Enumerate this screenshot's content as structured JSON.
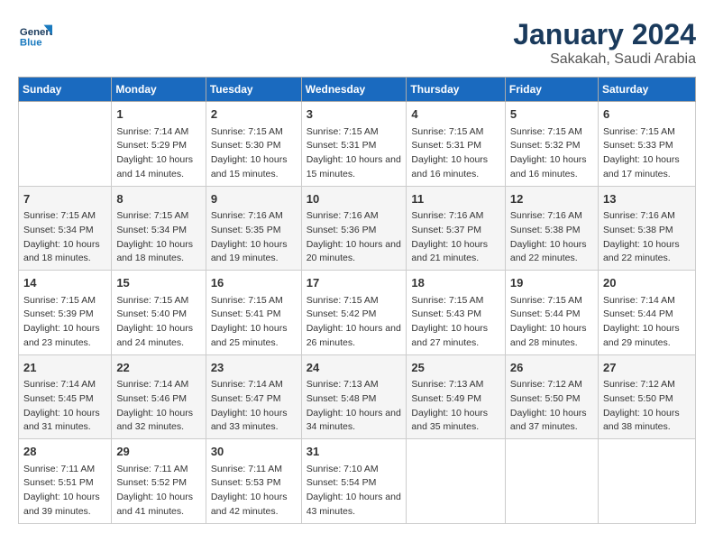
{
  "header": {
    "logo_general": "General",
    "logo_blue": "Blue",
    "month_year": "January 2024",
    "location": "Sakakah, Saudi Arabia"
  },
  "columns": [
    "Sunday",
    "Monday",
    "Tuesday",
    "Wednesday",
    "Thursday",
    "Friday",
    "Saturday"
  ],
  "weeks": [
    [
      {
        "day": "",
        "sunrise": "",
        "sunset": "",
        "daylight": ""
      },
      {
        "day": "1",
        "sunrise": "Sunrise: 7:14 AM",
        "sunset": "Sunset: 5:29 PM",
        "daylight": "Daylight: 10 hours and 14 minutes."
      },
      {
        "day": "2",
        "sunrise": "Sunrise: 7:15 AM",
        "sunset": "Sunset: 5:30 PM",
        "daylight": "Daylight: 10 hours and 15 minutes."
      },
      {
        "day": "3",
        "sunrise": "Sunrise: 7:15 AM",
        "sunset": "Sunset: 5:31 PM",
        "daylight": "Daylight: 10 hours and 15 minutes."
      },
      {
        "day": "4",
        "sunrise": "Sunrise: 7:15 AM",
        "sunset": "Sunset: 5:31 PM",
        "daylight": "Daylight: 10 hours and 16 minutes."
      },
      {
        "day": "5",
        "sunrise": "Sunrise: 7:15 AM",
        "sunset": "Sunset: 5:32 PM",
        "daylight": "Daylight: 10 hours and 16 minutes."
      },
      {
        "day": "6",
        "sunrise": "Sunrise: 7:15 AM",
        "sunset": "Sunset: 5:33 PM",
        "daylight": "Daylight: 10 hours and 17 minutes."
      }
    ],
    [
      {
        "day": "7",
        "sunrise": "Sunrise: 7:15 AM",
        "sunset": "Sunset: 5:34 PM",
        "daylight": "Daylight: 10 hours and 18 minutes."
      },
      {
        "day": "8",
        "sunrise": "Sunrise: 7:15 AM",
        "sunset": "Sunset: 5:34 PM",
        "daylight": "Daylight: 10 hours and 18 minutes."
      },
      {
        "day": "9",
        "sunrise": "Sunrise: 7:16 AM",
        "sunset": "Sunset: 5:35 PM",
        "daylight": "Daylight: 10 hours and 19 minutes."
      },
      {
        "day": "10",
        "sunrise": "Sunrise: 7:16 AM",
        "sunset": "Sunset: 5:36 PM",
        "daylight": "Daylight: 10 hours and 20 minutes."
      },
      {
        "day": "11",
        "sunrise": "Sunrise: 7:16 AM",
        "sunset": "Sunset: 5:37 PM",
        "daylight": "Daylight: 10 hours and 21 minutes."
      },
      {
        "day": "12",
        "sunrise": "Sunrise: 7:16 AM",
        "sunset": "Sunset: 5:38 PM",
        "daylight": "Daylight: 10 hours and 22 minutes."
      },
      {
        "day": "13",
        "sunrise": "Sunrise: 7:16 AM",
        "sunset": "Sunset: 5:38 PM",
        "daylight": "Daylight: 10 hours and 22 minutes."
      }
    ],
    [
      {
        "day": "14",
        "sunrise": "Sunrise: 7:15 AM",
        "sunset": "Sunset: 5:39 PM",
        "daylight": "Daylight: 10 hours and 23 minutes."
      },
      {
        "day": "15",
        "sunrise": "Sunrise: 7:15 AM",
        "sunset": "Sunset: 5:40 PM",
        "daylight": "Daylight: 10 hours and 24 minutes."
      },
      {
        "day": "16",
        "sunrise": "Sunrise: 7:15 AM",
        "sunset": "Sunset: 5:41 PM",
        "daylight": "Daylight: 10 hours and 25 minutes."
      },
      {
        "day": "17",
        "sunrise": "Sunrise: 7:15 AM",
        "sunset": "Sunset: 5:42 PM",
        "daylight": "Daylight: 10 hours and 26 minutes."
      },
      {
        "day": "18",
        "sunrise": "Sunrise: 7:15 AM",
        "sunset": "Sunset: 5:43 PM",
        "daylight": "Daylight: 10 hours and 27 minutes."
      },
      {
        "day": "19",
        "sunrise": "Sunrise: 7:15 AM",
        "sunset": "Sunset: 5:44 PM",
        "daylight": "Daylight: 10 hours and 28 minutes."
      },
      {
        "day": "20",
        "sunrise": "Sunrise: 7:14 AM",
        "sunset": "Sunset: 5:44 PM",
        "daylight": "Daylight: 10 hours and 29 minutes."
      }
    ],
    [
      {
        "day": "21",
        "sunrise": "Sunrise: 7:14 AM",
        "sunset": "Sunset: 5:45 PM",
        "daylight": "Daylight: 10 hours and 31 minutes."
      },
      {
        "day": "22",
        "sunrise": "Sunrise: 7:14 AM",
        "sunset": "Sunset: 5:46 PM",
        "daylight": "Daylight: 10 hours and 32 minutes."
      },
      {
        "day": "23",
        "sunrise": "Sunrise: 7:14 AM",
        "sunset": "Sunset: 5:47 PM",
        "daylight": "Daylight: 10 hours and 33 minutes."
      },
      {
        "day": "24",
        "sunrise": "Sunrise: 7:13 AM",
        "sunset": "Sunset: 5:48 PM",
        "daylight": "Daylight: 10 hours and 34 minutes."
      },
      {
        "day": "25",
        "sunrise": "Sunrise: 7:13 AM",
        "sunset": "Sunset: 5:49 PM",
        "daylight": "Daylight: 10 hours and 35 minutes."
      },
      {
        "day": "26",
        "sunrise": "Sunrise: 7:12 AM",
        "sunset": "Sunset: 5:50 PM",
        "daylight": "Daylight: 10 hours and 37 minutes."
      },
      {
        "day": "27",
        "sunrise": "Sunrise: 7:12 AM",
        "sunset": "Sunset: 5:50 PM",
        "daylight": "Daylight: 10 hours and 38 minutes."
      }
    ],
    [
      {
        "day": "28",
        "sunrise": "Sunrise: 7:11 AM",
        "sunset": "Sunset: 5:51 PM",
        "daylight": "Daylight: 10 hours and 39 minutes."
      },
      {
        "day": "29",
        "sunrise": "Sunrise: 7:11 AM",
        "sunset": "Sunset: 5:52 PM",
        "daylight": "Daylight: 10 hours and 41 minutes."
      },
      {
        "day": "30",
        "sunrise": "Sunrise: 7:11 AM",
        "sunset": "Sunset: 5:53 PM",
        "daylight": "Daylight: 10 hours and 42 minutes."
      },
      {
        "day": "31",
        "sunrise": "Sunrise: 7:10 AM",
        "sunset": "Sunset: 5:54 PM",
        "daylight": "Daylight: 10 hours and 43 minutes."
      },
      {
        "day": "",
        "sunrise": "",
        "sunset": "",
        "daylight": ""
      },
      {
        "day": "",
        "sunrise": "",
        "sunset": "",
        "daylight": ""
      },
      {
        "day": "",
        "sunrise": "",
        "sunset": "",
        "daylight": ""
      }
    ]
  ]
}
